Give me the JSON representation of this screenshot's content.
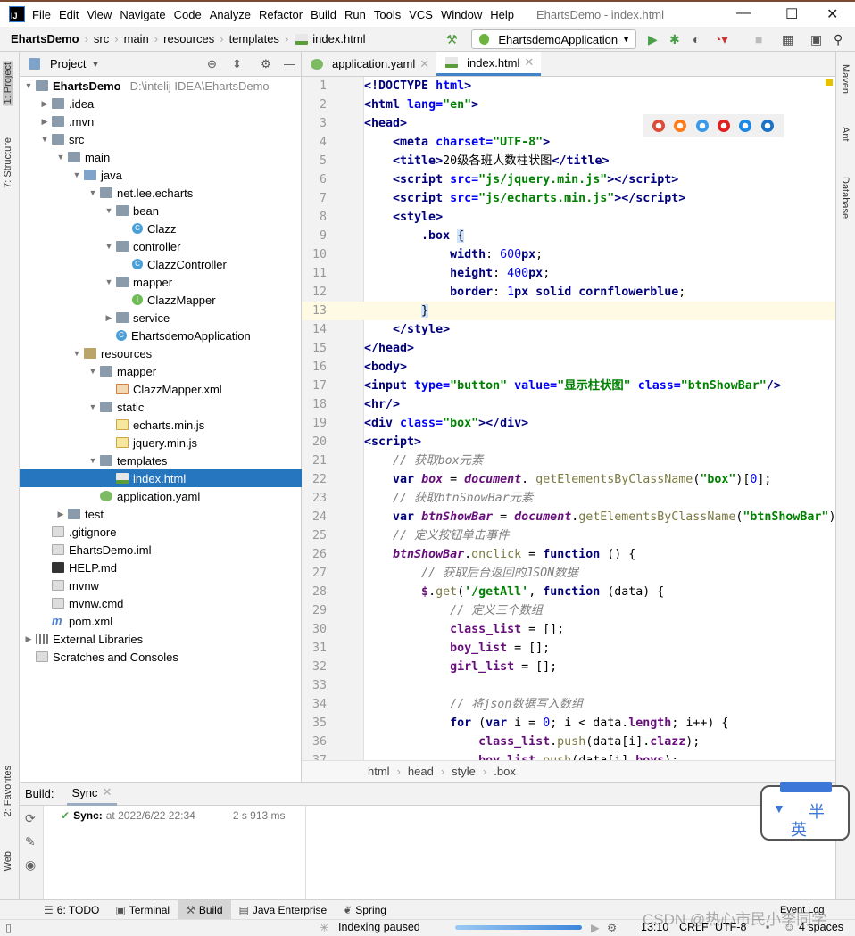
{
  "app": {
    "window_title": "EhartsDemo - index.html",
    "logo": "IJ"
  },
  "menu": [
    "File",
    "Edit",
    "View",
    "Navigate",
    "Code",
    "Analyze",
    "Refactor",
    "Build",
    "Run",
    "Tools",
    "VCS",
    "Window",
    "Help"
  ],
  "breadcrumb": [
    "EhartsDemo",
    "src",
    "main",
    "resources",
    "templates",
    "index.html"
  ],
  "run_config": "EhartsdemoApplication",
  "project_panel": {
    "title": "Project",
    "tree": [
      {
        "d": 0,
        "a": "open",
        "i": "folder",
        "t": "EhartsDemo",
        "extra": "D:\\intelij IDEA\\EhartsDemo",
        "bold": true
      },
      {
        "d": 1,
        "a": "closed",
        "i": "folder",
        "t": ".idea"
      },
      {
        "d": 1,
        "a": "closed",
        "i": "folder",
        "t": ".mvn"
      },
      {
        "d": 1,
        "a": "open",
        "i": "folder",
        "t": "src"
      },
      {
        "d": 2,
        "a": "open",
        "i": "folder",
        "t": "main"
      },
      {
        "d": 3,
        "a": "open",
        "i": "fsrc",
        "t": "java"
      },
      {
        "d": 4,
        "a": "open",
        "i": "folder",
        "t": "net.lee.echarts"
      },
      {
        "d": 5,
        "a": "open",
        "i": "folder",
        "t": "bean"
      },
      {
        "d": 6,
        "a": "",
        "i": "class",
        "t": "Clazz"
      },
      {
        "d": 5,
        "a": "open",
        "i": "folder",
        "t": "controller"
      },
      {
        "d": 6,
        "a": "",
        "i": "class",
        "t": "ClazzController"
      },
      {
        "d": 5,
        "a": "open",
        "i": "folder",
        "t": "mapper"
      },
      {
        "d": 6,
        "a": "",
        "i": "iface",
        "t": "ClazzMapper"
      },
      {
        "d": 5,
        "a": "closed",
        "i": "folder",
        "t": "service"
      },
      {
        "d": 5,
        "a": "",
        "i": "class",
        "t": "EhartsdemoApplication"
      },
      {
        "d": 3,
        "a": "open",
        "i": "fres",
        "t": "resources"
      },
      {
        "d": 4,
        "a": "open",
        "i": "folder",
        "t": "mapper"
      },
      {
        "d": 5,
        "a": "",
        "i": "xml",
        "t": "ClazzMapper.xml"
      },
      {
        "d": 4,
        "a": "open",
        "i": "folder",
        "t": "static"
      },
      {
        "d": 5,
        "a": "",
        "i": "js",
        "t": "echarts.min.js"
      },
      {
        "d": 5,
        "a": "",
        "i": "js",
        "t": "jquery.min.js"
      },
      {
        "d": 4,
        "a": "open",
        "i": "folder",
        "t": "templates"
      },
      {
        "d": 5,
        "a": "",
        "i": "html",
        "t": "index.html",
        "selected": true
      },
      {
        "d": 4,
        "a": "",
        "i": "yaml",
        "t": "application.yaml"
      },
      {
        "d": 2,
        "a": "closed",
        "i": "folder",
        "t": "test"
      },
      {
        "d": 1,
        "a": "",
        "i": "file",
        "t": ".gitignore"
      },
      {
        "d": 1,
        "a": "",
        "i": "file",
        "t": "EhartsDemo.iml"
      },
      {
        "d": 1,
        "a": "",
        "i": "md",
        "t": "HELP.md"
      },
      {
        "d": 1,
        "a": "",
        "i": "file",
        "t": "mvnw"
      },
      {
        "d": 1,
        "a": "",
        "i": "file",
        "t": "mvnw.cmd"
      },
      {
        "d": 1,
        "a": "",
        "i": "maven",
        "t": "pom.xml"
      },
      {
        "d": 0,
        "a": "closed",
        "i": "lib",
        "t": "External Libraries"
      },
      {
        "d": 0,
        "a": "",
        "i": "file",
        "t": "Scratches and Consoles"
      }
    ]
  },
  "left_stripe": [
    "1: Project",
    "7: Structure",
    "2: Favorites",
    "Web"
  ],
  "right_stripe": [
    "Maven",
    "Ant",
    "Database"
  ],
  "editor": {
    "tabs": [
      {
        "label": "application.yaml",
        "active": false
      },
      {
        "label": "index.html",
        "active": true
      }
    ],
    "current_line": 13,
    "first_line": 1,
    "lines": [
      [
        [
          "t-tag",
          "<!DOCTYPE "
        ],
        [
          "t-attr",
          "html"
        ],
        [
          "t-tag",
          ">"
        ]
      ],
      [
        [
          "t-tag",
          "<html "
        ],
        [
          "t-attr",
          "lang="
        ],
        [
          "t-str",
          "\"en\""
        ],
        [
          "t-tag",
          ">"
        ]
      ],
      [
        [
          "t-tag",
          "<head>"
        ]
      ],
      [
        [
          "",
          "    "
        ],
        [
          "t-tag",
          "<meta "
        ],
        [
          "t-attr",
          "charset="
        ],
        [
          "t-str",
          "\"UTF-8\""
        ],
        [
          "t-tag",
          ">"
        ]
      ],
      [
        [
          "",
          "    "
        ],
        [
          "t-tag",
          "<title>"
        ],
        [
          "",
          "20级各班人数柱状图"
        ],
        [
          "t-tag",
          "</title>"
        ]
      ],
      [
        [
          "",
          "    "
        ],
        [
          "t-tag",
          "<script "
        ],
        [
          "t-attr",
          "src="
        ],
        [
          "t-str",
          "\"js/jquery.min.js\""
        ],
        [
          "t-tag",
          "></script>"
        ]
      ],
      [
        [
          "",
          "    "
        ],
        [
          "t-tag",
          "<script "
        ],
        [
          "t-attr",
          "src="
        ],
        [
          "t-str",
          "\"js/echarts.min.js\""
        ],
        [
          "t-tag",
          "></script>"
        ]
      ],
      [
        [
          "",
          "    "
        ],
        [
          "t-tag",
          "<style>"
        ]
      ],
      [
        [
          "",
          "        "
        ],
        [
          "t-prop",
          ".box "
        ],
        [
          "t-hl",
          "{"
        ]
      ],
      [
        [
          "",
          "            "
        ],
        [
          "t-prop",
          "width"
        ],
        [
          "",
          ": "
        ],
        [
          "t-num",
          "600"
        ],
        [
          "t-prop",
          "px"
        ],
        [
          "",
          ";"
        ]
      ],
      [
        [
          "",
          "            "
        ],
        [
          "t-prop",
          "height"
        ],
        [
          "",
          ": "
        ],
        [
          "t-num",
          "400"
        ],
        [
          "t-prop",
          "px"
        ],
        [
          "",
          ";"
        ]
      ],
      [
        [
          "",
          "            "
        ],
        [
          "t-prop",
          "border"
        ],
        [
          "",
          ": "
        ],
        [
          "t-num",
          "1"
        ],
        [
          "t-prop",
          "px solid cornflowerblue"
        ],
        [
          "",
          ";"
        ]
      ],
      [
        [
          "",
          "        "
        ],
        [
          "t-hl",
          "}"
        ]
      ],
      [
        [
          "",
          "    "
        ],
        [
          "t-tag",
          "</style>"
        ]
      ],
      [
        [
          "t-tag",
          "</head>"
        ]
      ],
      [
        [
          "t-tag",
          "<body>"
        ]
      ],
      [
        [
          "t-tag",
          "<input "
        ],
        [
          "t-attr",
          "type="
        ],
        [
          "t-str",
          "\"button\" "
        ],
        [
          "t-attr",
          "value="
        ],
        [
          "t-str",
          "\"显示柱状图\" "
        ],
        [
          "t-attr",
          "class="
        ],
        [
          "t-str",
          "\"btnShowBar\""
        ],
        [
          "t-tag",
          "/>"
        ]
      ],
      [
        [
          "t-tag",
          "<hr/>"
        ]
      ],
      [
        [
          "t-tag",
          "<div "
        ],
        [
          "t-attr",
          "class="
        ],
        [
          "t-str",
          "\"box\""
        ],
        [
          "t-tag",
          "></div>"
        ]
      ],
      [
        [
          "t-tag",
          "<script>"
        ]
      ],
      [
        [
          "",
          "    "
        ],
        [
          "t-cm",
          "// 获取box元素"
        ]
      ],
      [
        [
          "",
          "    "
        ],
        [
          "t-kw",
          "var "
        ],
        [
          "t-var",
          "box"
        ],
        [
          "",
          " = "
        ],
        [
          "t-var",
          "document"
        ],
        [
          "",
          ". "
        ],
        [
          "t-fn",
          "getElementsByClassName"
        ],
        [
          "",
          "("
        ],
        [
          "t-str",
          "\"box\""
        ],
        [
          "",
          ")["
        ],
        [
          "t-num",
          "0"
        ],
        [
          "",
          "];"
        ]
      ],
      [
        [
          "",
          "    "
        ],
        [
          "t-cm",
          "// 获取btnShowBar元素"
        ]
      ],
      [
        [
          "",
          "    "
        ],
        [
          "t-kw",
          "var "
        ],
        [
          "t-var",
          "btnShowBar"
        ],
        [
          "",
          " = "
        ],
        [
          "t-var",
          "document"
        ],
        [
          "",
          "."
        ],
        [
          "t-fn",
          "getElementsByClassName"
        ],
        [
          "",
          "("
        ],
        [
          "t-str",
          "\"btnShowBar\""
        ],
        [
          "",
          ")"
        ]
      ],
      [
        [
          "",
          "    "
        ],
        [
          "t-cm",
          "// 定义按钮单击事件"
        ]
      ],
      [
        [
          "",
          "    "
        ],
        [
          "t-var",
          "btnShowBar"
        ],
        [
          "",
          "."
        ],
        [
          "t-fn",
          "onclick"
        ],
        [
          "",
          " = "
        ],
        [
          "t-kw",
          "function "
        ],
        [
          "",
          "() {"
        ]
      ],
      [
        [
          "",
          "        "
        ],
        [
          "t-cm",
          "// 获取后台返回的JSON数据"
        ]
      ],
      [
        [
          "",
          "        "
        ],
        [
          "t-gv",
          "$"
        ],
        [
          "",
          "."
        ],
        [
          "t-fn",
          "get"
        ],
        [
          "",
          "("
        ],
        [
          "t-str",
          "'/getAll'"
        ],
        [
          "",
          ", "
        ],
        [
          "t-kw",
          "function "
        ],
        [
          "",
          "(data) {"
        ]
      ],
      [
        [
          "",
          "            "
        ],
        [
          "t-cm",
          "// 定义三个数组"
        ]
      ],
      [
        [
          "",
          "            "
        ],
        [
          "t-gv",
          "class_list"
        ],
        [
          "",
          " = [];"
        ]
      ],
      [
        [
          "",
          "            "
        ],
        [
          "t-gv",
          "boy_list"
        ],
        [
          "",
          " = [];"
        ]
      ],
      [
        [
          "",
          "            "
        ],
        [
          "t-gv",
          "girl_list"
        ],
        [
          "",
          " = [];"
        ]
      ],
      [
        [
          "",
          ""
        ]
      ],
      [
        [
          "",
          "            "
        ],
        [
          "t-cm",
          "// 将json数据写入数组"
        ]
      ],
      [
        [
          "",
          "            "
        ],
        [
          "t-kw",
          "for "
        ],
        [
          "",
          "("
        ],
        [
          "t-kw",
          "var "
        ],
        [
          "",
          "i = "
        ],
        [
          "t-num",
          "0"
        ],
        [
          "",
          "; i < data."
        ],
        [
          "t-gv",
          "length"
        ],
        [
          "",
          "; i++) {"
        ]
      ],
      [
        [
          "",
          "                "
        ],
        [
          "t-gv",
          "class_list"
        ],
        [
          "",
          "."
        ],
        [
          "t-fn",
          "push"
        ],
        [
          "",
          "(data[i]."
        ],
        [
          "t-gv",
          "clazz"
        ],
        [
          "",
          ");"
        ]
      ],
      [
        [
          "",
          "                "
        ],
        [
          "t-gv",
          "boy_list"
        ],
        [
          "",
          "."
        ],
        [
          "t-fn",
          "push"
        ],
        [
          "",
          "(data[i]."
        ],
        [
          "t-gv",
          "boys"
        ],
        [
          "",
          ");"
        ]
      ]
    ],
    "structure_breadcrumb": [
      "html",
      "head",
      "style",
      ".box"
    ],
    "browser_icons": [
      "chrome-icon",
      "firefox-icon",
      "safari-icon",
      "opera-icon",
      "ie-icon",
      "edge-icon"
    ]
  },
  "build": {
    "label": "Build:",
    "tab": "Sync",
    "sync_title": "Sync:",
    "sync_time": "at 2022/6/22 22:34",
    "duration": "2 s 913 ms"
  },
  "tool_windows": [
    {
      "label": "6: TODO"
    },
    {
      "label": "Terminal"
    },
    {
      "label": "Build",
      "active": true
    },
    {
      "label": "Java Enterprise"
    },
    {
      "label": "Spring"
    }
  ],
  "event_log": "Event Log",
  "status": {
    "indexing": "Indexing paused",
    "position": "13:10",
    "line_sep": "CRLF",
    "encoding": "UTF-8",
    "indent": "4 spaces"
  },
  "watermark": "CSDN @热心市民小李同学",
  "ime": {
    "chars": [
      "半",
      "英"
    ]
  },
  "colors": {
    "accent": "#2675bf",
    "current_line": "#fffae3",
    "tag": "#000080",
    "string": "#008000"
  }
}
